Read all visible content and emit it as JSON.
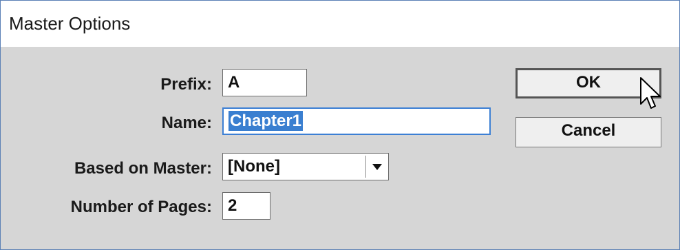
{
  "dialog": {
    "title": "Master Options"
  },
  "fields": {
    "prefix_label": "Prefix:",
    "prefix_value": "A",
    "name_label": "Name:",
    "name_value": "Chapter1",
    "based_on_label": "Based on Master:",
    "based_on_value": "[None]",
    "pages_label": "Number of Pages:",
    "pages_value": "2"
  },
  "buttons": {
    "ok_label": "OK",
    "cancel_label": "Cancel"
  },
  "colors": {
    "dialog_bg": "#d6d6d6",
    "title_bg": "#ffffff",
    "focus_border": "#3c7fd4",
    "selection": "#3a7fd0"
  },
  "icons": {
    "cursor": "mouse-pointer-icon",
    "dropdown": "chevron-down-icon"
  }
}
